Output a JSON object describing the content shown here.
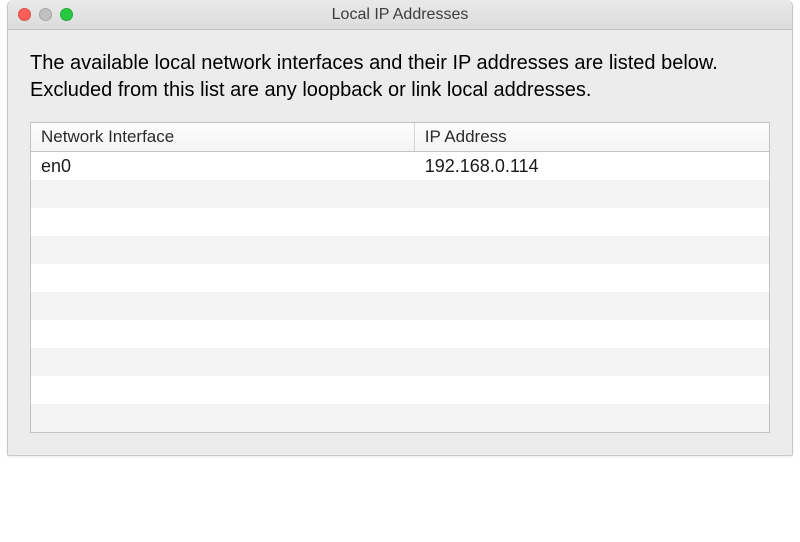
{
  "window": {
    "title": "Local IP Addresses"
  },
  "description": "The available local network interfaces and their IP addresses are listed below.  Excluded from this list are any loopback or link local addresses.",
  "table": {
    "headers": {
      "interface": "Network Interface",
      "ip": "IP Address"
    },
    "rows": [
      {
        "interface": "en0",
        "ip": "192.168.0.114"
      },
      {
        "interface": "",
        "ip": ""
      },
      {
        "interface": "",
        "ip": ""
      },
      {
        "interface": "",
        "ip": ""
      },
      {
        "interface": "",
        "ip": ""
      },
      {
        "interface": "",
        "ip": ""
      },
      {
        "interface": "",
        "ip": ""
      },
      {
        "interface": "",
        "ip": ""
      },
      {
        "interface": "",
        "ip": ""
      },
      {
        "interface": "",
        "ip": ""
      }
    ]
  }
}
